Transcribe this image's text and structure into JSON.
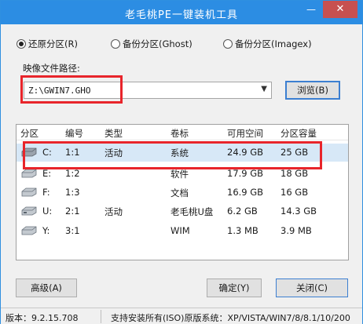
{
  "window": {
    "title": "老毛桃PE一键装机工具",
    "minimize_glyph": "—",
    "close_glyph": "✕"
  },
  "modes": [
    {
      "label": "还原分区(R)",
      "selected": true
    },
    {
      "label": "备份分区(Ghost)",
      "selected": false
    },
    {
      "label": "备份分区(Imagex)",
      "selected": false
    }
  ],
  "image_path": {
    "label": "映像文件路径:",
    "value": "Z:\\GWIN7.GHO",
    "browse_label": "浏览(B)"
  },
  "partition_table": {
    "columns": [
      "分区",
      "编号",
      "类型",
      "卷标",
      "可用空间",
      "分区容量"
    ],
    "rows": [
      {
        "drive": "C:",
        "number": "1:1",
        "type": "活动",
        "label": "系统",
        "free": "24.9 GB",
        "size": "25 GB",
        "selected": true
      },
      {
        "drive": "E:",
        "number": "1:2",
        "type": "",
        "label": "软件",
        "free": "17.9 GB",
        "size": "18 GB",
        "selected": false
      },
      {
        "drive": "F:",
        "number": "1:3",
        "type": "",
        "label": "文档",
        "free": "16.9 GB",
        "size": "16 GB",
        "selected": false
      },
      {
        "drive": "U:",
        "number": "2:1",
        "type": "活动",
        "label": "老毛桃U盘",
        "free": "6.2 GB",
        "size": "14.3 GB",
        "selected": false
      },
      {
        "drive": "Y:",
        "number": "3:1",
        "type": "",
        "label": "WIM",
        "free": "1.3 MB",
        "size": "3.9 MB",
        "selected": false
      }
    ]
  },
  "buttons": {
    "advanced": "高级(A)",
    "ok": "确定(Y)",
    "close": "关闭(C)"
  },
  "status": {
    "version": "版本：9.2.15.708",
    "info": "支持安装所有(ISO)原版系统：XP/VISTA/WIN7/8/8.1/10/200"
  },
  "colors": {
    "titlebar": "#2c8de3",
    "highlight_box": "#e8252b",
    "selected_row": "#d7e8f7"
  }
}
